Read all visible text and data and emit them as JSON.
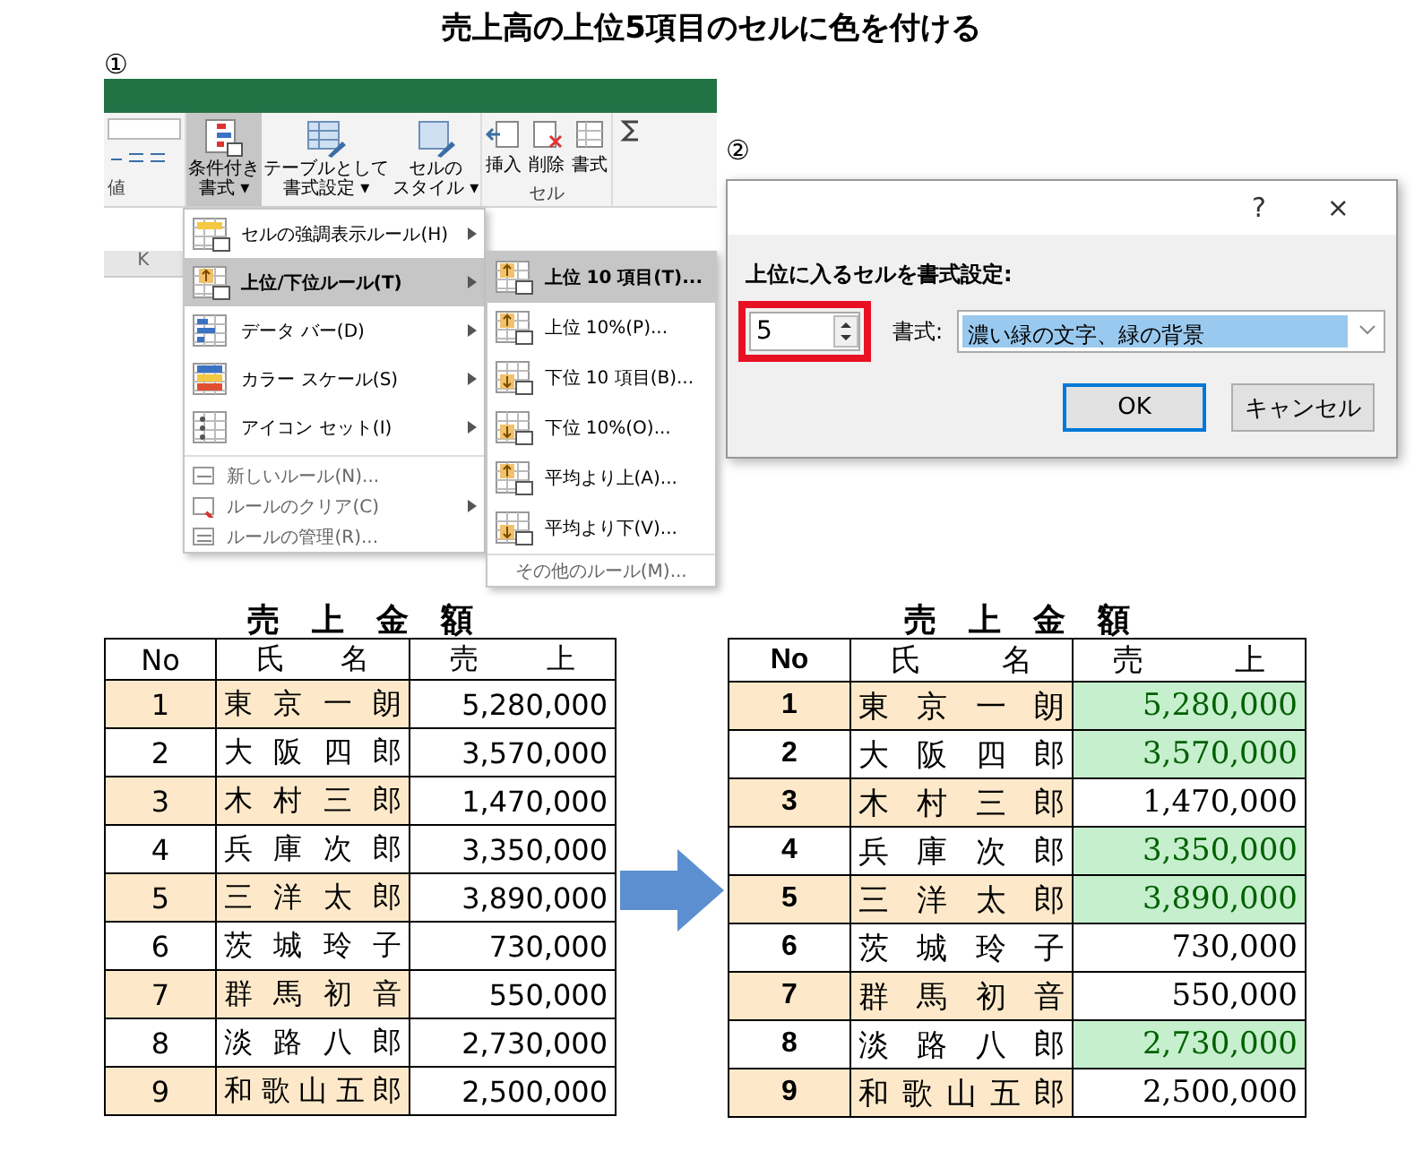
{
  "title": "売上高の上位5項目のセルに色を付ける",
  "step_1": {
    "marker": "①",
    "ribbon": {
      "number_label": "値",
      "column_header": "K",
      "cell_group": "セル",
      "buttons": [
        {
          "lines": [
            "条件付き",
            "書式 ▾"
          ],
          "kind": "conditional",
          "selected": true
        },
        {
          "lines": [
            "テーブルとして",
            "書式設定 ▾"
          ],
          "kind": "table",
          "selected": false
        },
        {
          "lines": [
            "セルの",
            "スタイル ▾"
          ],
          "kind": "style",
          "selected": false
        }
      ],
      "cell_buttons": [
        {
          "label": "挿入",
          "kind": "insert"
        },
        {
          "label": "削除",
          "kind": "delete"
        },
        {
          "label": "書式",
          "kind": "format"
        }
      ]
    },
    "menu": [
      {
        "label": "セルの強調表示ルール(H)",
        "kind": "highlight",
        "submenu": true,
        "selected": false
      },
      {
        "label": "上位/下位ルール(T)",
        "kind": "topbottom",
        "submenu": true,
        "selected": true
      },
      {
        "label": "データ バー(D)",
        "kind": "databar",
        "submenu": true,
        "selected": false
      },
      {
        "label": "カラー スケール(S)",
        "kind": "colorscale",
        "submenu": true,
        "selected": false
      },
      {
        "label": "アイコン セット(I)",
        "kind": "iconset",
        "submenu": true,
        "selected": false
      },
      {
        "label": "新しいルール(N)...",
        "kind": "new",
        "submenu": false,
        "selected": false
      },
      {
        "label": "ルールのクリア(C)",
        "kind": "clear",
        "submenu": true,
        "selected": false
      },
      {
        "label": "ルールの管理(R)...",
        "kind": "manage",
        "submenu": false,
        "selected": false
      }
    ],
    "submenu": [
      {
        "label": "上位 10 項目(T)...",
        "kind": "top",
        "selected": true
      },
      {
        "label": "上位 10%(P)...",
        "kind": "top",
        "selected": false
      },
      {
        "label": "下位 10 項目(B)...",
        "kind": "bottom",
        "selected": false
      },
      {
        "label": "下位 10%(O)...",
        "kind": "bottom",
        "selected": false
      },
      {
        "label": "平均より上(A)...",
        "kind": "top",
        "selected": false
      },
      {
        "label": "平均より下(V)...",
        "kind": "bottom",
        "selected": false
      },
      {
        "label": "その他のルール(M)...",
        "kind": "more",
        "selected": false
      }
    ]
  },
  "step_2": {
    "marker": "②",
    "dialog": {
      "help": "?",
      "close": "×",
      "prompt": "上位に入るセルを書式設定:",
      "count": "5",
      "format_label": "書式:",
      "format_value": "濃い緑の文字、緑の背景",
      "buttons": [
        "OK",
        "キャンセル"
      ]
    }
  },
  "table_before": {
    "title": "売　上　金　額",
    "columns": [
      "No",
      "氏　名",
      "売　上"
    ],
    "rows": [
      {
        "no": "1",
        "name": "東 京 一 朗",
        "sales": "5,280,000",
        "shaded": true,
        "highlighted": false
      },
      {
        "no": "2",
        "name": "大 阪 四 郎",
        "sales": "3,570,000",
        "shaded": false,
        "highlighted": false
      },
      {
        "no": "3",
        "name": "木 村 三 郎",
        "sales": "1,470,000",
        "shaded": true,
        "highlighted": false
      },
      {
        "no": "4",
        "name": "兵 庫 次 郎",
        "sales": "3,350,000",
        "shaded": false,
        "highlighted": false
      },
      {
        "no": "5",
        "name": "三 洋 太 郎",
        "sales": "3,890,000",
        "shaded": true,
        "highlighted": false
      },
      {
        "no": "6",
        "name": "茨 城 玲 子",
        "sales": "730,000",
        "shaded": false,
        "highlighted": false
      },
      {
        "no": "7",
        "name": "群 馬 初 音",
        "sales": "550,000",
        "shaded": true,
        "highlighted": false
      },
      {
        "no": "8",
        "name": "淡 路 八 郎",
        "sales": "2,730,000",
        "shaded": false,
        "highlighted": false
      },
      {
        "no": "9",
        "name": "和歌山五郎",
        "sales": "2,500,000",
        "shaded": true,
        "highlighted": false
      }
    ]
  },
  "table_after": {
    "title": "売　上　金　額",
    "columns": [
      "No",
      "氏　名",
      "売　上"
    ],
    "rows": [
      {
        "no": "1",
        "name": "東 京 一 朗",
        "sales": "5,280,000",
        "shaded": true,
        "highlighted": true
      },
      {
        "no": "2",
        "name": "大 阪 四 郎",
        "sales": "3,570,000",
        "shaded": false,
        "highlighted": true
      },
      {
        "no": "3",
        "name": "木 村 三 郎",
        "sales": "1,470,000",
        "shaded": true,
        "highlighted": false
      },
      {
        "no": "4",
        "name": "兵 庫 次 郎",
        "sales": "3,350,000",
        "shaded": false,
        "highlighted": true
      },
      {
        "no": "5",
        "name": "三 洋 太 郎",
        "sales": "3,890,000",
        "shaded": true,
        "highlighted": true
      },
      {
        "no": "6",
        "name": "茨 城 玲 子",
        "sales": "730,000",
        "shaded": false,
        "highlighted": false
      },
      {
        "no": "7",
        "name": "群 馬 初 音",
        "sales": "550,000",
        "shaded": true,
        "highlighted": false
      },
      {
        "no": "8",
        "name": "淡 路 八 郎",
        "sales": "2,730,000",
        "shaded": false,
        "highlighted": true
      },
      {
        "no": "9",
        "name": "和歌山五郎",
        "sales": "2,500,000",
        "shaded": true,
        "highlighted": false
      }
    ]
  }
}
